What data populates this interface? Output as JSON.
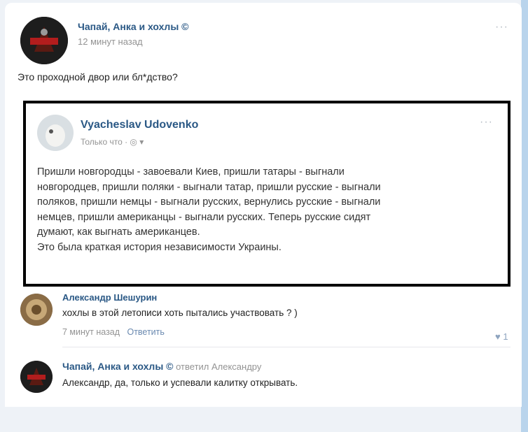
{
  "post": {
    "author": "Чапай, Анка и хохлы ©",
    "time": "12 минут назад",
    "menu": "···",
    "text": "Это проходной двор или бл*дство?"
  },
  "quote": {
    "author": "Vyacheslav Udovenko",
    "time": "Только что · ◎ ▾",
    "menu": "···",
    "lines": [
      "Пришли новгородцы - завоевали Киев, пришли татары - выгнали",
      "новгородцев, пришли поляки - выгнали татар, пришли русские - выгнали",
      "поляков, пришли немцы - выгнали русских, вернулись русские - выгнали",
      "немцев, пришли американцы - выгнали русских. Теперь русские сидят",
      "думают, как выгнать американцев.",
      "Это была краткая история независимости Украины."
    ]
  },
  "comments": [
    {
      "author": "Александр Шешурин",
      "text": "хохлы в этой летописи хоть пытались участвовать ? )",
      "time": "7 минут назад",
      "reply_label": "Ответить",
      "likes": "♥ 1"
    },
    {
      "author": "Чапай, Анка и хохлы ©",
      "replied_to": "ответил Александру",
      "text": "Александр, да, только и успевали калитку открывать."
    }
  ],
  "colors": {
    "link": "#2a5885",
    "muted": "#939393",
    "page_bg": "#eef2f7"
  }
}
